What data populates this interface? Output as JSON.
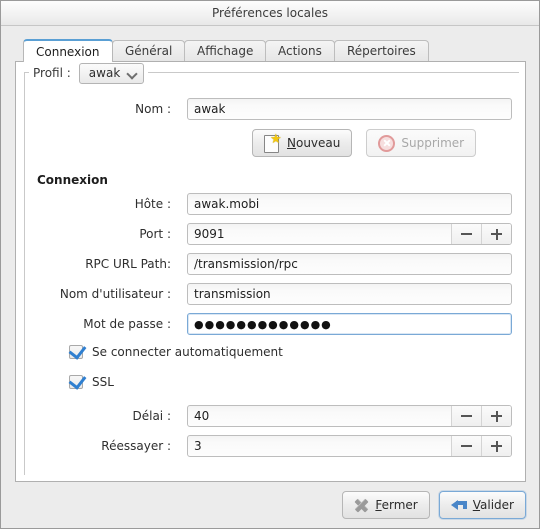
{
  "window": {
    "title": "Préférences locales"
  },
  "tabs": [
    {
      "label": "Connexion",
      "active": true
    },
    {
      "label": "Général",
      "active": false
    },
    {
      "label": "Affichage",
      "active": false
    },
    {
      "label": "Actions",
      "active": false
    },
    {
      "label": "Répertoires",
      "active": false
    }
  ],
  "profile_group": {
    "label": "Profil :",
    "selected": "awak",
    "chevron_icon": "chevron-down-icon"
  },
  "fields": {
    "name": {
      "label": "Nom :",
      "value": "awak"
    },
    "host": {
      "label": "Hôte :",
      "value": "awak.mobi"
    },
    "port": {
      "label": "Port :",
      "value": "9091"
    },
    "rpc_url_path": {
      "label": "RPC URL Path:",
      "value": "/transmission/rpc"
    },
    "username": {
      "label": "Nom d'utilisateur :",
      "value": "transmission"
    },
    "password": {
      "label": "Mot de passe :",
      "value": "●●●●●●●●●●●●●"
    },
    "delay": {
      "label": "Délai :",
      "value": "40"
    },
    "retry": {
      "label": "Réessayer :",
      "value": "3"
    }
  },
  "profile_actions": {
    "new_label": "Nouveau",
    "new_icon": "new-document-icon",
    "new_mnemonic": "N",
    "delete_label": "Supprimer",
    "delete_icon": "delete-circle-icon",
    "delete_disabled": true
  },
  "section": {
    "connexion_title": "Connexion"
  },
  "checkboxes": [
    {
      "label": "Se connecter automatiquement",
      "checked": true
    },
    {
      "label": "SSL",
      "checked": true
    }
  ],
  "spinners": {
    "minus_icon": "minus-icon",
    "plus_icon": "plus-icon"
  },
  "footer": {
    "close_label": "Fermer",
    "close_mnemonic": "F",
    "close_icon": "close-x-icon",
    "ok_label": "Valider",
    "ok_mnemonic": "V",
    "ok_icon": "enter-arrow-icon",
    "ok_is_default": true
  },
  "colors": {
    "accent": "#5a9fd4",
    "focus_border": "#7aa9d6",
    "checkmark": "#2f7fd0",
    "window_bg": "#ececec",
    "panel_bg": "#ffffff",
    "star": "#f3c70f",
    "delete_red": "#e19a9a"
  }
}
